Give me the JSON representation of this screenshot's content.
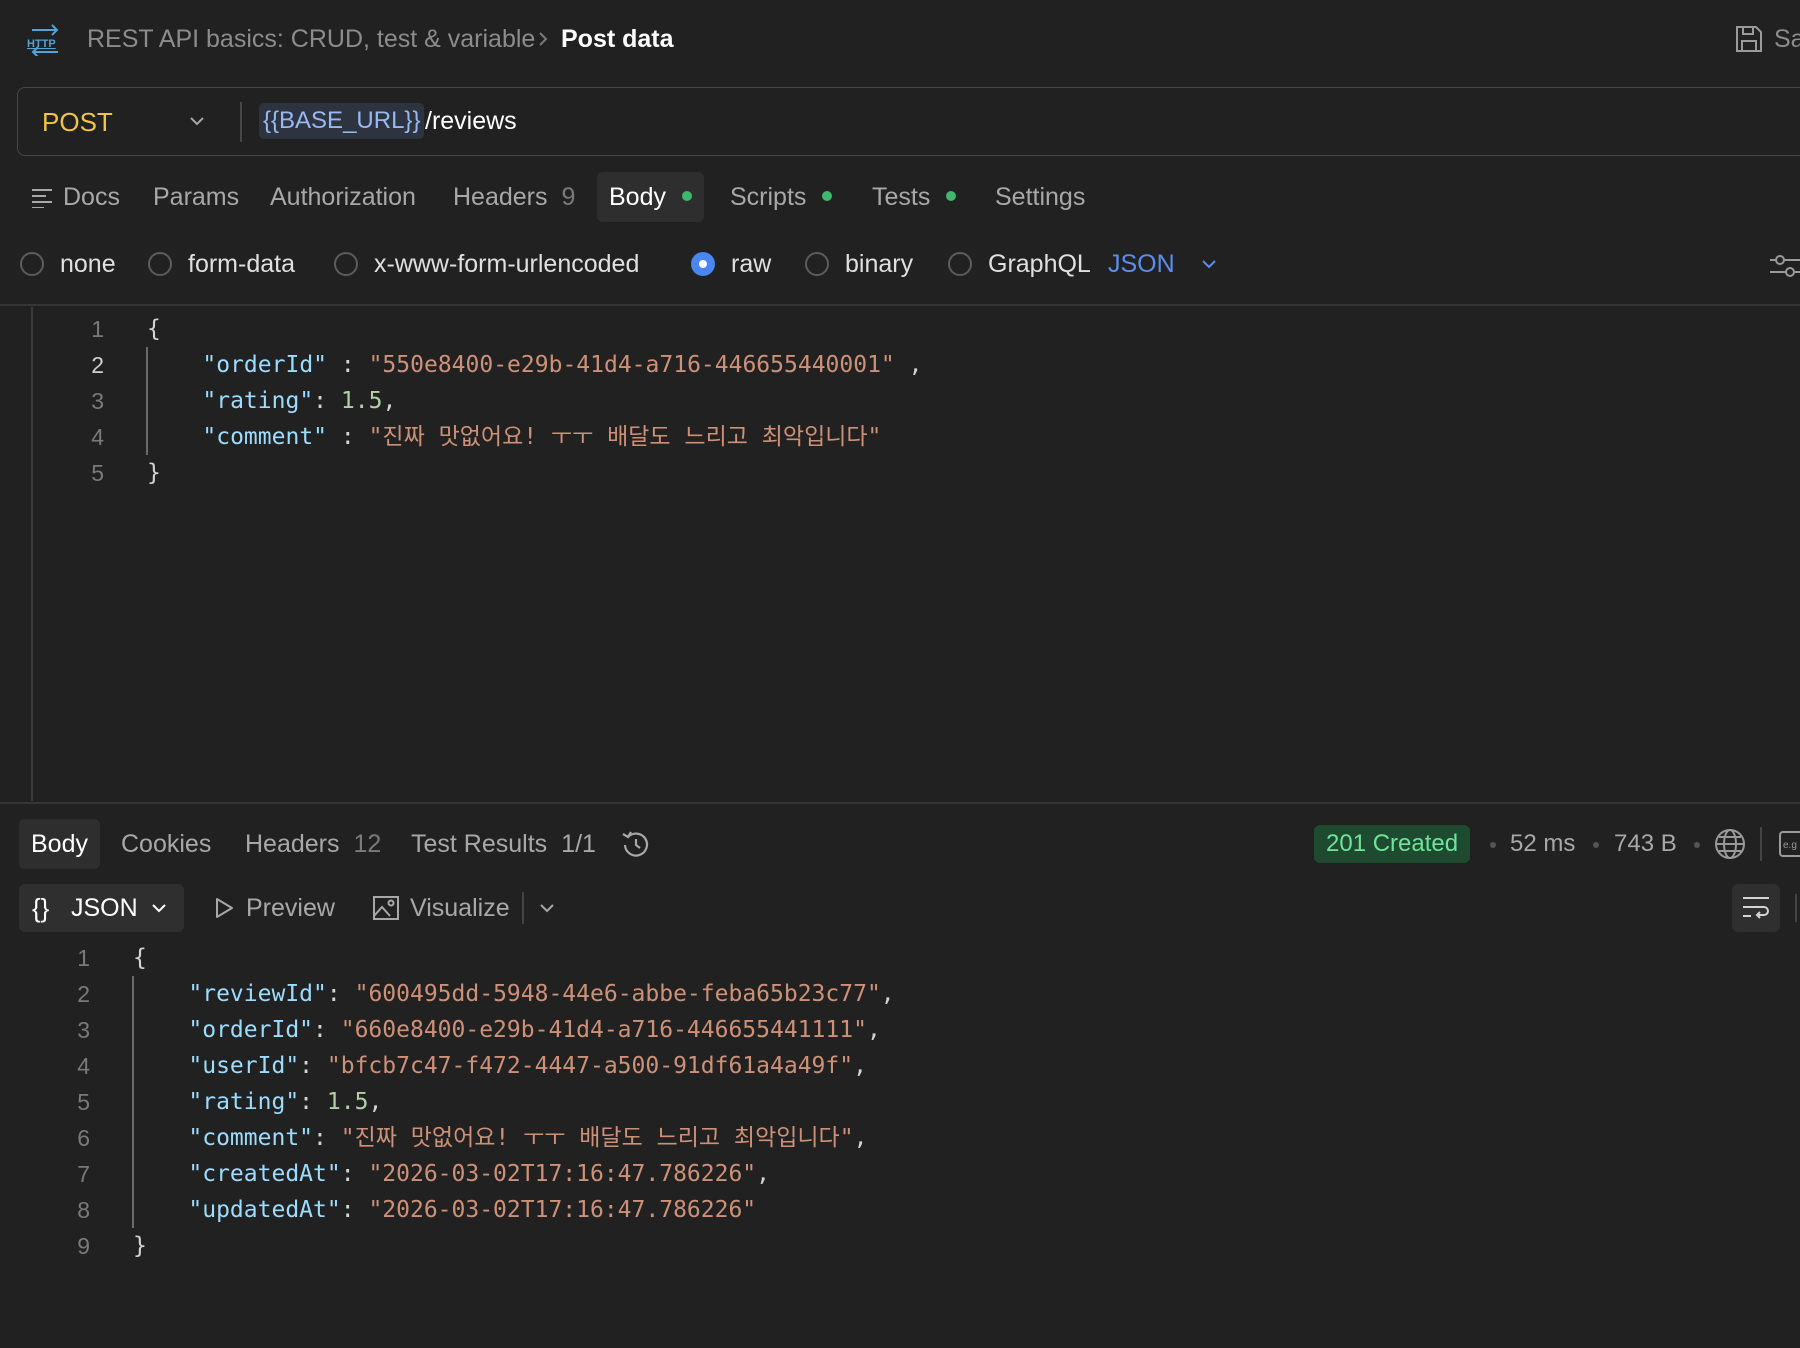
{
  "breadcrumb": {
    "parent": "REST API basics: CRUD, test & variable",
    "current": "Post data",
    "save_label": "Sa"
  },
  "request": {
    "method": "POST",
    "url_variable": "{{BASE_URL}}",
    "url_path": "/reviews"
  },
  "request_tabs": [
    {
      "label": "Docs"
    },
    {
      "label": "Params"
    },
    {
      "label": "Authorization"
    },
    {
      "label": "Headers",
      "count": "9"
    },
    {
      "label": "Body",
      "active": true,
      "dot": true
    },
    {
      "label": "Scripts",
      "dot": true
    },
    {
      "label": "Tests",
      "dot": true
    },
    {
      "label": "Settings"
    }
  ],
  "body_types": [
    {
      "label": "none",
      "checked": false
    },
    {
      "label": "form-data",
      "checked": false
    },
    {
      "label": "x-www-form-urlencoded",
      "checked": false
    },
    {
      "label": "raw",
      "checked": true
    },
    {
      "label": "binary",
      "checked": false
    },
    {
      "label": "GraphQL",
      "checked": false
    }
  ],
  "body_language": "JSON",
  "request_body_lines": [
    {
      "n": "1",
      "text": "{"
    },
    {
      "n": "2",
      "text": "    \"orderId\" : \"550e8400-e29b-41d4-a716-446655440001\" ,"
    },
    {
      "n": "3",
      "text": "    \"rating\": 1.5,"
    },
    {
      "n": "4",
      "text": "    \"comment\" : \"진짜 맛없어요! ㅜㅜ 배달도 느리고 최악입니다\""
    },
    {
      "n": "5",
      "text": "}"
    }
  ],
  "response_tabs": [
    {
      "label": "Body",
      "active": true
    },
    {
      "label": "Cookies"
    },
    {
      "label": "Headers",
      "count": "12"
    },
    {
      "label": "Test Results",
      "count": "1/1"
    }
  ],
  "response_meta": {
    "status": "201 Created",
    "time": "52 ms",
    "size": "743 B"
  },
  "response_toolbar": {
    "format": "JSON",
    "braces": "{}",
    "preview": "Preview",
    "visualize": "Visualize"
  },
  "response_body_lines": [
    {
      "n": "1",
      "text": "{"
    },
    {
      "n": "2",
      "text": "    \"reviewId\": \"600495dd-5948-44e6-abbe-feba65b23c77\","
    },
    {
      "n": "3",
      "text": "    \"orderId\": \"660e8400-e29b-41d4-a716-446655441111\","
    },
    {
      "n": "4",
      "text": "    \"userId\": \"bfcb7c47-f472-4447-a500-91df61a4a49f\","
    },
    {
      "n": "5",
      "text": "    \"rating\": 1.5,"
    },
    {
      "n": "6",
      "text": "    \"comment\": \"진짜 맛없어요! ㅜㅜ 배달도 느리고 최악입니다\","
    },
    {
      "n": "7",
      "text": "    \"createdAt\": \"2026-03-02T17:16:47.786226\","
    },
    {
      "n": "8",
      "text": "    \"updatedAt\": \"2026-03-02T17:16:47.786226\""
    },
    {
      "n": "9",
      "text": "}"
    }
  ],
  "colors": {
    "accent": "#4a86f0",
    "method": "#f0c541",
    "status_ok": "#6ee39a",
    "json_key": "#9cdcfe",
    "json_string": "#ce9178",
    "json_number": "#b5cea8"
  },
  "icons": [
    "http-icon",
    "chevron-right-icon",
    "save-icon",
    "chevron-down-icon",
    "docs-icon",
    "beautify-icon",
    "history-icon",
    "globe-icon",
    "example-icon",
    "play-icon",
    "image-icon",
    "wrap-icon"
  ]
}
